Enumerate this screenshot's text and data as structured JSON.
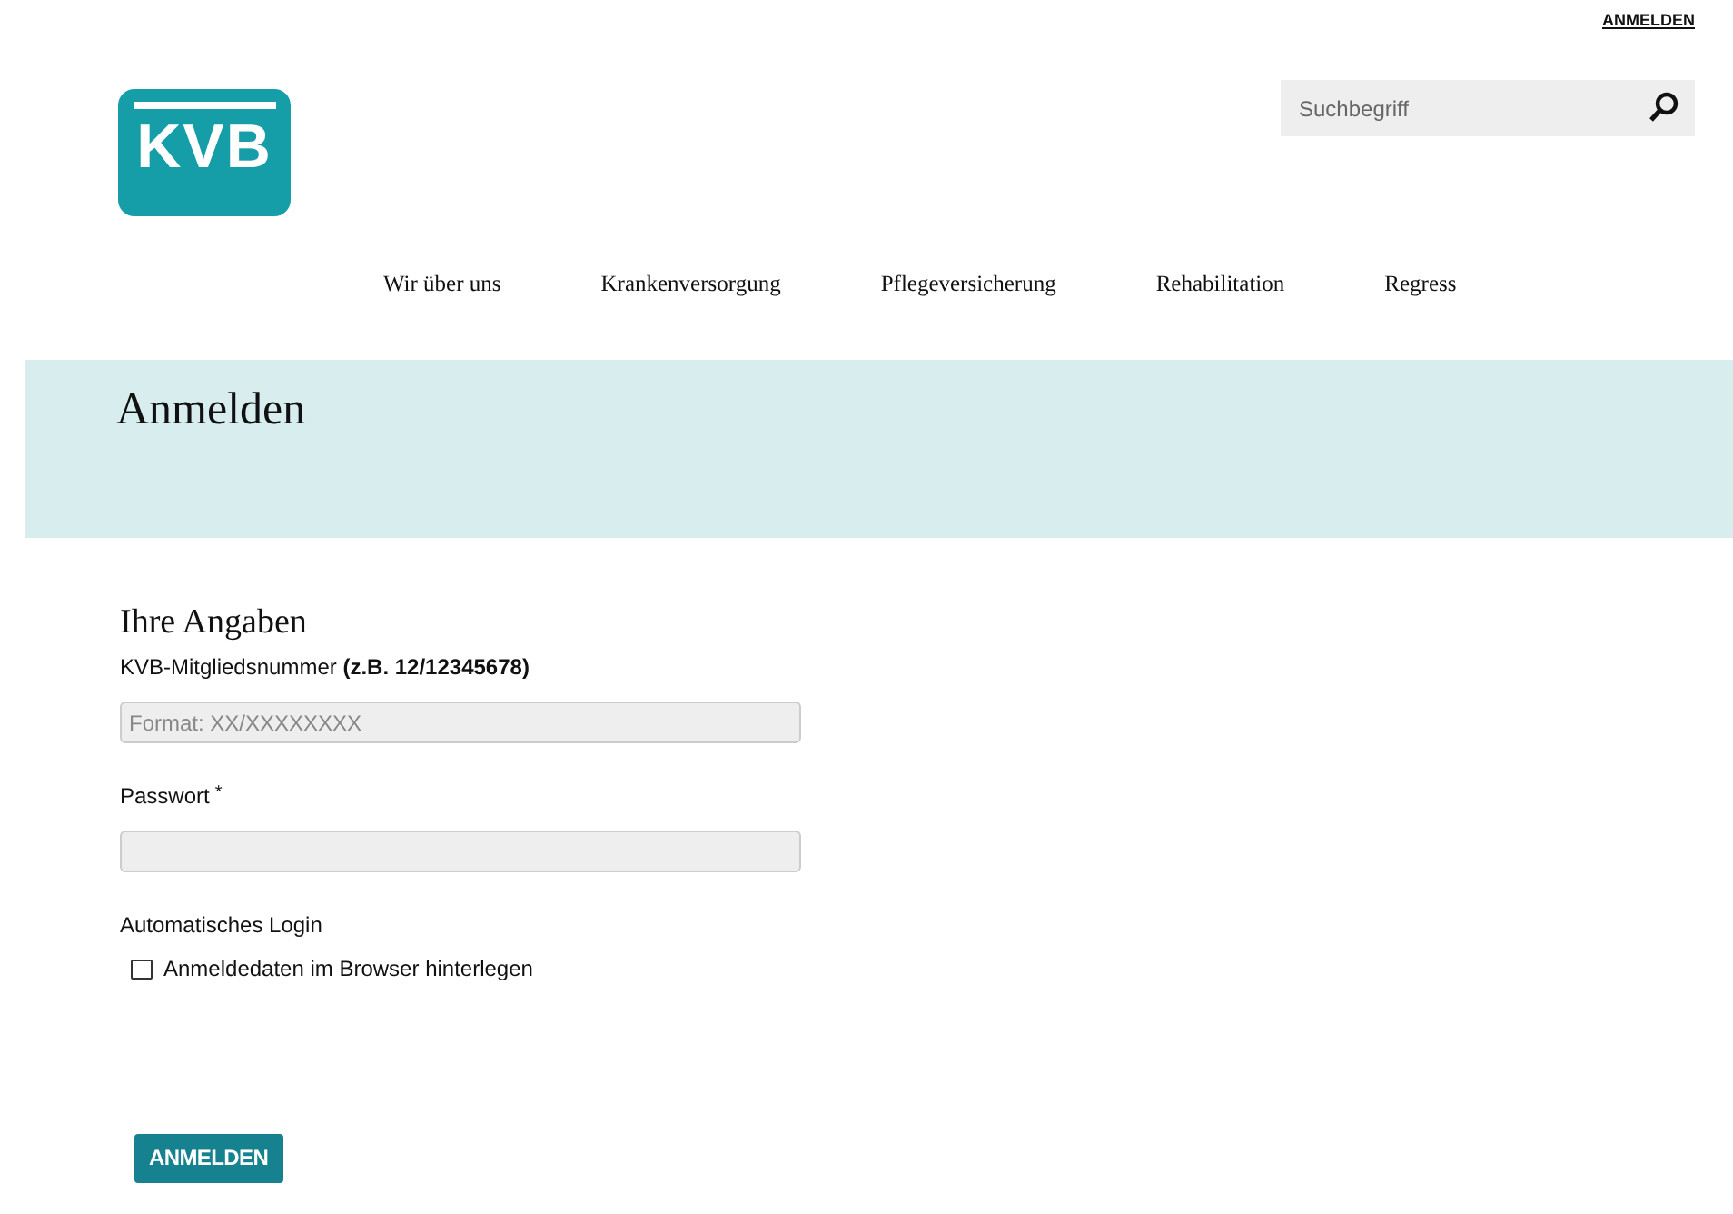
{
  "top_link": "ANMELDEN",
  "logo": {
    "text": "KVB"
  },
  "search": {
    "placeholder": "Suchbegriff"
  },
  "nav": [
    "Wir über uns",
    "Krankenversorgung",
    "Pflegeversicherung",
    "Rehabilitation",
    "Regress"
  ],
  "banner": {
    "title": "Anmelden"
  },
  "form": {
    "heading": "Ihre Angaben",
    "member_label": "KVB-Mitgliedsnummer **(z.B. 12/12345678)**",
    "member_field": {
      "placeholder": "Format: XX/XXXXXXXX"
    },
    "password_label": "Passwort",
    "required_mark": "*",
    "auto_login_label": "Automatisches Login",
    "remember": {
      "label": "Anmeldedaten im Browser hinterlegen",
      "checked": false
    },
    "submit": "ANMELDEN"
  }
}
